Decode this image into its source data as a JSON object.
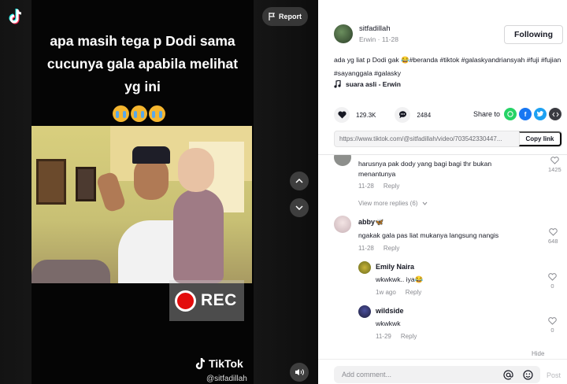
{
  "video": {
    "report_label": "Report",
    "caption": "apa masih tega p Dodi sama cucunya gala apabila melihat yg ini",
    "rec_label": "REC",
    "watermark_brand": "TikTok",
    "watermark_user": "@sitfadillah"
  },
  "author": {
    "username": "sitfadillah",
    "display_name": "Erwin",
    "date": "11-28",
    "follow_label": "Following"
  },
  "description": {
    "text": "ada yg liat p Dodi gak 😂#beranda #tiktok #galaskyandriansyah #fuji #fujian #sayanggala #galasky",
    "sound": "suara asli - Erwin"
  },
  "stats": {
    "likes": "129.3K",
    "comments": "2484",
    "share_label": "Share to"
  },
  "link": {
    "url": "https://www.tiktok.com/@sitfadillah/video/703542330447...",
    "copy_label": "Copy link"
  },
  "comments": [
    {
      "text": "harusnya pak dody yang bagi bagi thr bukan menantunya",
      "date": "11-28",
      "reply_label": "Reply",
      "likes": "1425",
      "view_more": "View more replies (6)"
    },
    {
      "name": "abby🦋",
      "text": "ngakak gala pas liat mukanya langsung nangis",
      "date": "11-28",
      "reply_label": "Reply",
      "likes": "648",
      "replies": [
        {
          "name": "Emily Naira",
          "text": "wkwkwk.. iya😂",
          "date": "1w ago",
          "reply_label": "Reply",
          "likes": "0"
        },
        {
          "name": "wildside",
          "text": "wkwkwk",
          "date": "11-29",
          "reply_label": "Reply",
          "likes": "0"
        }
      ],
      "hide_label": "Hide"
    }
  ],
  "comment_bar": {
    "placeholder": "Add comment...",
    "post_label": "Post"
  },
  "colors": {
    "tiktok_red": "#fe2c55",
    "rec_red": "#e30c0c",
    "whatsapp": "#25d366",
    "facebook": "#1877f2",
    "twitter": "#1da1f2"
  }
}
